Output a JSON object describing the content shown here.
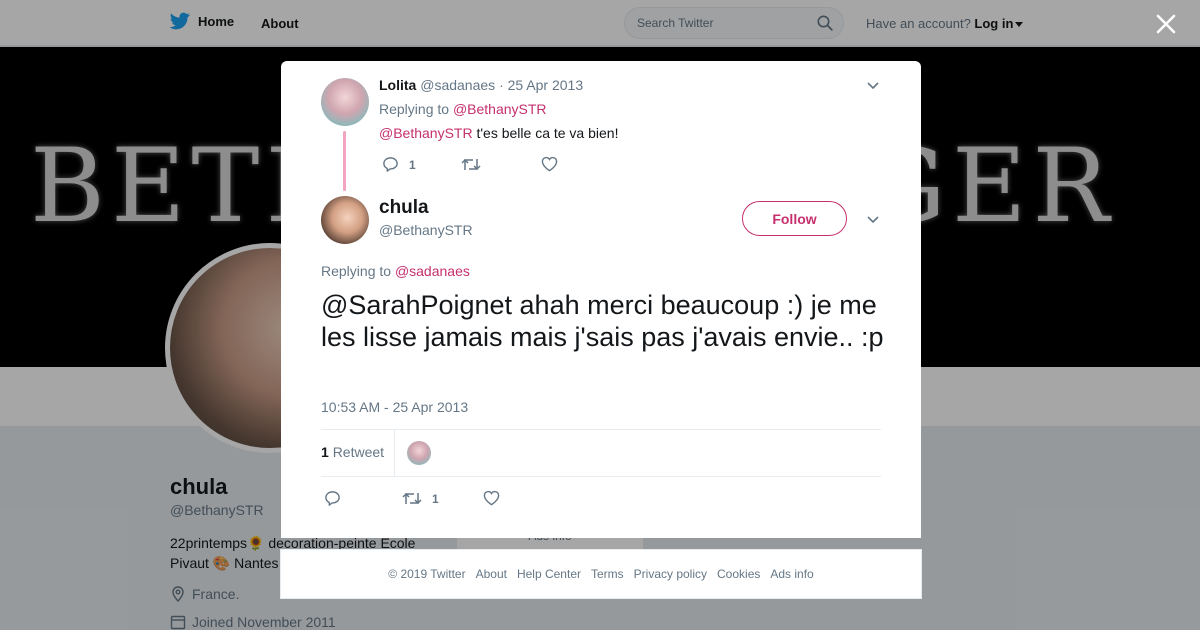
{
  "nav": {
    "home_label": "Home",
    "about_label": "About",
    "search_placeholder": "Search Twitter",
    "account_prompt": "Have an account?",
    "login_label": "Log in"
  },
  "profile": {
    "banner_text": "BETHANY SINGER",
    "name": "chula",
    "handle": "@BethanySTR",
    "bio": "22printemps🌻 decoration-peinte Ecole Pivaut 🎨 Nantes",
    "location": "France.",
    "joined": "Joined November 2011",
    "ads_info": "Ads info"
  },
  "reply_tweet": {
    "name": "Lolita",
    "handle": "@sadanaes",
    "date": "· 25 Apr 2013",
    "replying_prefix": "Replying to",
    "replying_to": "@BethanySTR",
    "mention": "@BethanySTR",
    "text": " t'es belle ca te va bien!",
    "reply_count": "1",
    "retweet_count": "",
    "like_count": ""
  },
  "main_tweet": {
    "name": "chula",
    "handle": "@BethanySTR",
    "follow_label": "Follow",
    "replying_prefix": "Replying to",
    "replying_to": "@sadanaes",
    "text": "@SarahPoignet ahah merci beaucoup :) je me les lisse jamais mais j'sais pas j'avais envie.. :p",
    "timestamp": "10:53 AM - 25 Apr 2013",
    "retweets_count": "1",
    "retweets_label": "Retweet",
    "action_retweet_count": "1"
  },
  "footer": {
    "copyright": "© 2019 Twitter",
    "about": "About",
    "help": "Help Center",
    "terms": "Terms",
    "privacy": "Privacy policy",
    "cookies": "Cookies",
    "ads": "Ads info"
  },
  "colors": {
    "accent": "#c5306d",
    "twitter_blue": "#1da1f2",
    "muted": "#657786",
    "thread_line": "#f2a3c2"
  },
  "icons": [
    "twitter-bird-icon",
    "search-icon",
    "close-icon",
    "reply-icon",
    "retweet-icon",
    "like-icon",
    "chevron-down-icon",
    "location-icon",
    "calendar-icon"
  ]
}
